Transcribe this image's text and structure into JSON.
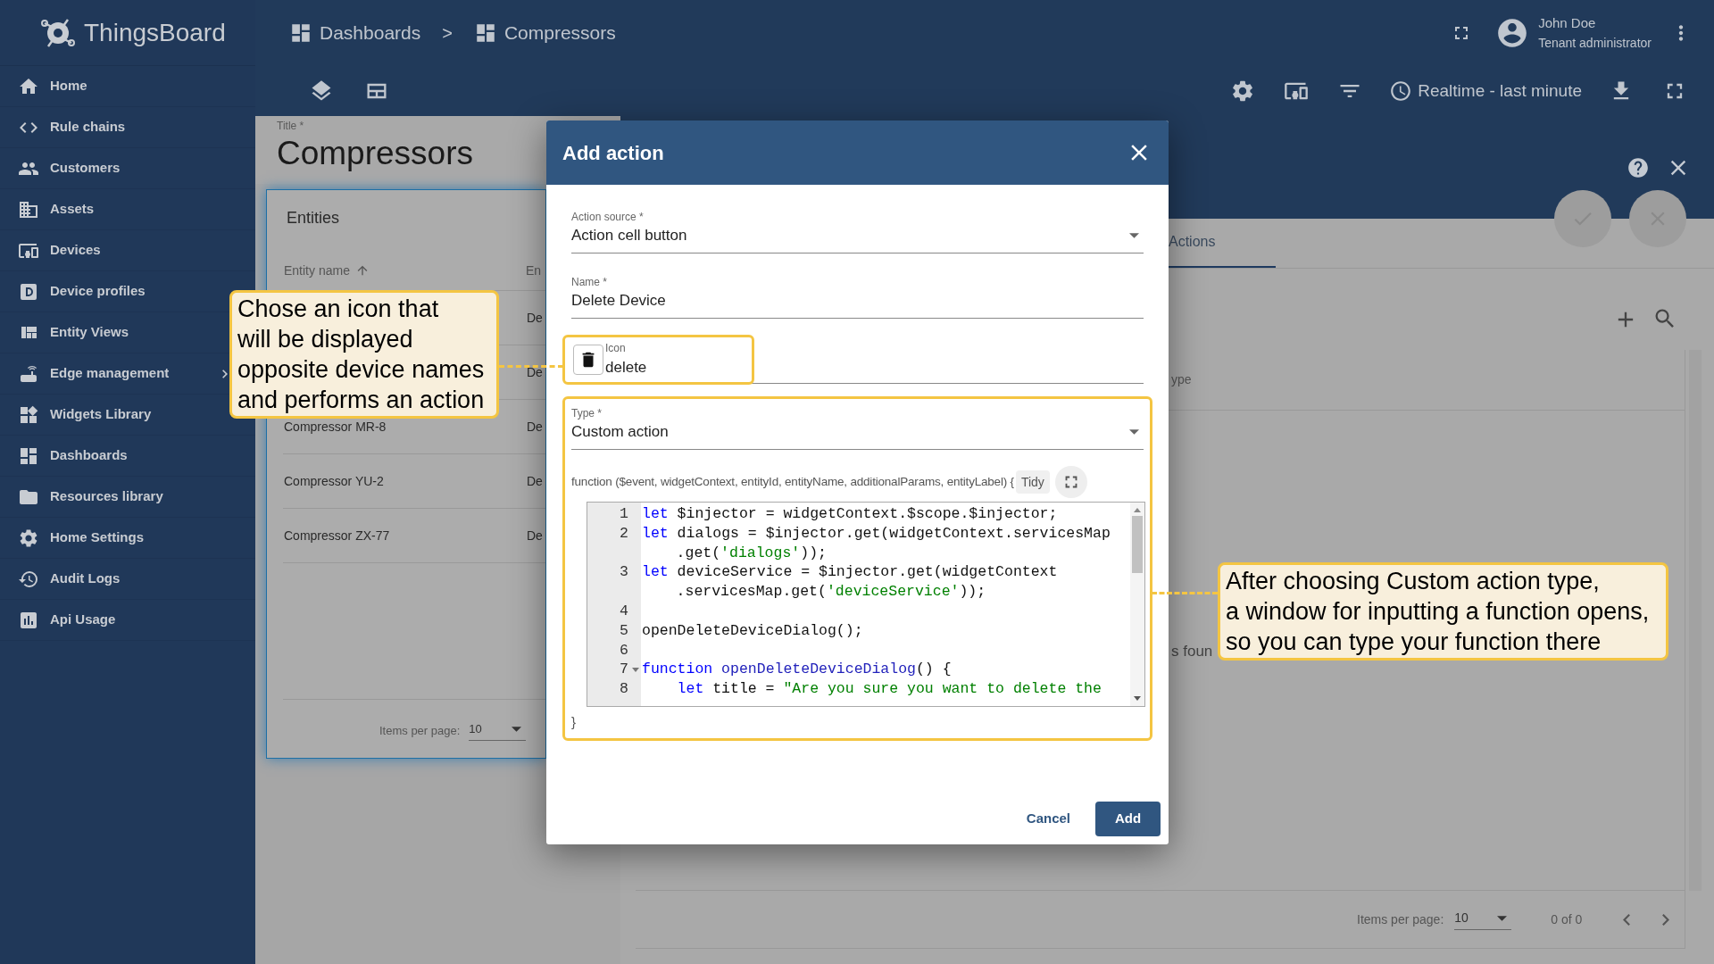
{
  "header": {
    "app_name": "ThingsBoard",
    "breadcrumbs": [
      {
        "label": "Dashboards"
      },
      {
        "label": "Compressors"
      }
    ],
    "separator": ">",
    "user": {
      "name": "John Doe",
      "role": "Tenant administrator"
    },
    "timewindow": "Realtime - last minute"
  },
  "sidebar": {
    "items": [
      {
        "label": "Home",
        "expandable": false
      },
      {
        "label": "Rule chains",
        "expandable": false
      },
      {
        "label": "Customers",
        "expandable": false
      },
      {
        "label": "Assets",
        "expandable": false
      },
      {
        "label": "Devices",
        "expandable": false
      },
      {
        "label": "Device profiles",
        "expandable": false
      },
      {
        "label": "Entity Views",
        "expandable": false
      },
      {
        "label": "Edge management",
        "expandable": true
      },
      {
        "label": "Widgets Library",
        "expandable": false
      },
      {
        "label": "Dashboards",
        "expandable": false
      },
      {
        "label": "Resources library",
        "expandable": false
      },
      {
        "label": "Home Settings",
        "expandable": false
      },
      {
        "label": "Audit Logs",
        "expandable": false
      },
      {
        "label": "Api Usage",
        "expandable": false
      }
    ]
  },
  "dashboard": {
    "title_label": "Title *",
    "title": "Compressors",
    "widget": {
      "title": "Entities",
      "columns": [
        {
          "label": "Entity name",
          "sorted": true
        },
        {
          "label": "En",
          "sorted": false
        }
      ],
      "rows": [
        {
          "type": "De"
        },
        {
          "type": "De"
        },
        {
          "name": "Compressor MR-8",
          "type": "De"
        },
        {
          "name": "Compressor YU-2",
          "type": "De"
        },
        {
          "name": "Compressor ZX-77",
          "type": "De"
        }
      ],
      "paginator": {
        "label": "Items per page:",
        "value": "10"
      }
    }
  },
  "edit_panel": {
    "tabs": [
      {
        "label": "Actions",
        "selected": true
      }
    ],
    "column_fragment": "ype",
    "empty_text": "s foun",
    "paginator": {
      "label": "Items per page:",
      "value": "10",
      "range": "0 of 0"
    }
  },
  "dialog": {
    "title": "Add action",
    "fields": [
      {
        "kind": "select",
        "label": "Action source *",
        "value": "Action cell button"
      },
      {
        "kind": "text",
        "label": "Name *",
        "value": "Delete Device"
      },
      {
        "kind": "icon",
        "label": "Icon",
        "value": "delete"
      },
      {
        "kind": "select",
        "label": "Type *",
        "value": "Custom action"
      }
    ],
    "function_signature": "function ($event, widgetContext, entityId, entityName, additionalParams, entityLabel) {",
    "tidy": "Tidy",
    "code_lines": [
      {
        "number": "1",
        "fold": false,
        "rows": [
          {
            "tokens": [
              {
                "kind": "keyword",
                "text": "let"
              },
              {
                "kind": "plain",
                "text": " $injector = widgetContext.$scope.$injector;"
              }
            ]
          }
        ]
      },
      {
        "number": "2",
        "fold": false,
        "rows": [
          {
            "tokens": [
              {
                "kind": "keyword",
                "text": "let"
              },
              {
                "kind": "plain",
                "text": " dialogs = $injector.get(widgetContext.servicesMap"
              }
            ]
          },
          {
            "tokens": [
              {
                "kind": "plain",
                "text": ".get("
              },
              {
                "kind": "string",
                "text": "'dialogs'"
              },
              {
                "kind": "plain",
                "text": "));"
              }
            ]
          }
        ]
      },
      {
        "number": "3",
        "fold": false,
        "rows": [
          {
            "tokens": [
              {
                "kind": "keyword",
                "text": "let"
              },
              {
                "kind": "plain",
                "text": " deviceService = $injector.get(widgetContext"
              }
            ]
          },
          {
            "tokens": [
              {
                "kind": "plain",
                "text": ".servicesMap.get("
              },
              {
                "kind": "string",
                "text": "'deviceService'"
              },
              {
                "kind": "plain",
                "text": "));"
              }
            ]
          }
        ]
      },
      {
        "number": "4",
        "fold": false
      },
      {
        "number": "5",
        "fold": false,
        "rows": [
          {
            "tokens": [
              {
                "kind": "plain",
                "text": "openDeleteDeviceDialog();"
              }
            ]
          }
        ]
      },
      {
        "number": "6",
        "fold": false
      },
      {
        "number": "7",
        "fold": true,
        "rows": [
          {
            "tokens": [
              {
                "kind": "keyword",
                "text": "function"
              },
              {
                "kind": "function",
                "text": " openDeleteDeviceDialog"
              },
              {
                "kind": "plain",
                "text": "() {"
              }
            ]
          }
        ]
      },
      {
        "number": "8",
        "fold": false,
        "rows": [
          {
            "tokens": [
              {
                "kind": "keyword",
                "text": "    let"
              },
              {
                "kind": "plain",
                "text": " title = "
              },
              {
                "kind": "string",
                "text": "\"Are you sure you want to delete the"
              }
            ]
          }
        ]
      }
    ],
    "closing": "}",
    "buttons": [
      {
        "label": "Cancel",
        "kind": "flat"
      },
      {
        "label": "Add",
        "kind": "primary"
      }
    ]
  },
  "callouts": [
    {
      "text": "Chose an icon that\nwill be displayed\nopposite device names\nand performs an action"
    },
    {
      "text": "After choosing Custom action type,\na window for inputting a function opens,\nso you can type your function there"
    }
  ]
}
